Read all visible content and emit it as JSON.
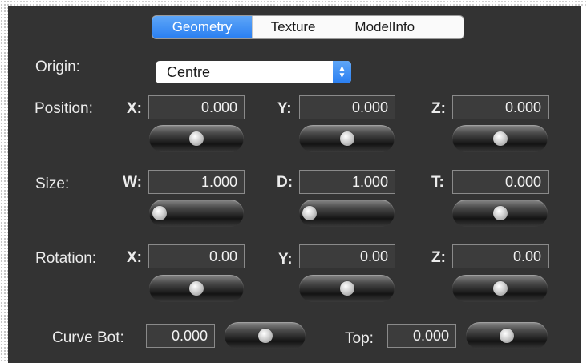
{
  "tabs": [
    {
      "label": "Geometry",
      "active": true
    },
    {
      "label": "Texture",
      "active": false
    },
    {
      "label": "ModelInfo",
      "active": false
    }
  ],
  "origin": {
    "label": "Origin:",
    "value": "Centre"
  },
  "position": {
    "label": "Position:",
    "x": {
      "axis": "X:",
      "value": "0.000",
      "slider": 0.5
    },
    "y": {
      "axis": "Y:",
      "value": "0.000",
      "slider": 0.5
    },
    "z": {
      "axis": "Z:",
      "value": "0.000",
      "slider": 0.5
    }
  },
  "size": {
    "label": "Size:",
    "w": {
      "axis": "W:",
      "value": "1.000",
      "slider": 0.0
    },
    "d": {
      "axis": "D:",
      "value": "1.000",
      "slider": 0.0
    },
    "t": {
      "axis": "T:",
      "value": "0.000",
      "slider": 0.5
    }
  },
  "rotation": {
    "label": "Rotation:",
    "x": {
      "axis": "X:",
      "value": "0.00",
      "slider": 0.5
    },
    "y": {
      "axis": "Y:",
      "value": "0.00",
      "slider": 0.5
    },
    "z": {
      "axis": "Z:",
      "value": "0.00",
      "slider": 0.5
    }
  },
  "curve": {
    "bot_label": "Curve Bot:",
    "bot_value": "0.000",
    "bot_slider": 0.5,
    "top_label": "Top:",
    "top_value": "0.000",
    "top_slider": 0.5
  },
  "colors": {
    "panel": "#333333",
    "accent": "#2a7ff2"
  },
  "icons": {
    "select_arrows": "chevron-up-down-icon"
  }
}
